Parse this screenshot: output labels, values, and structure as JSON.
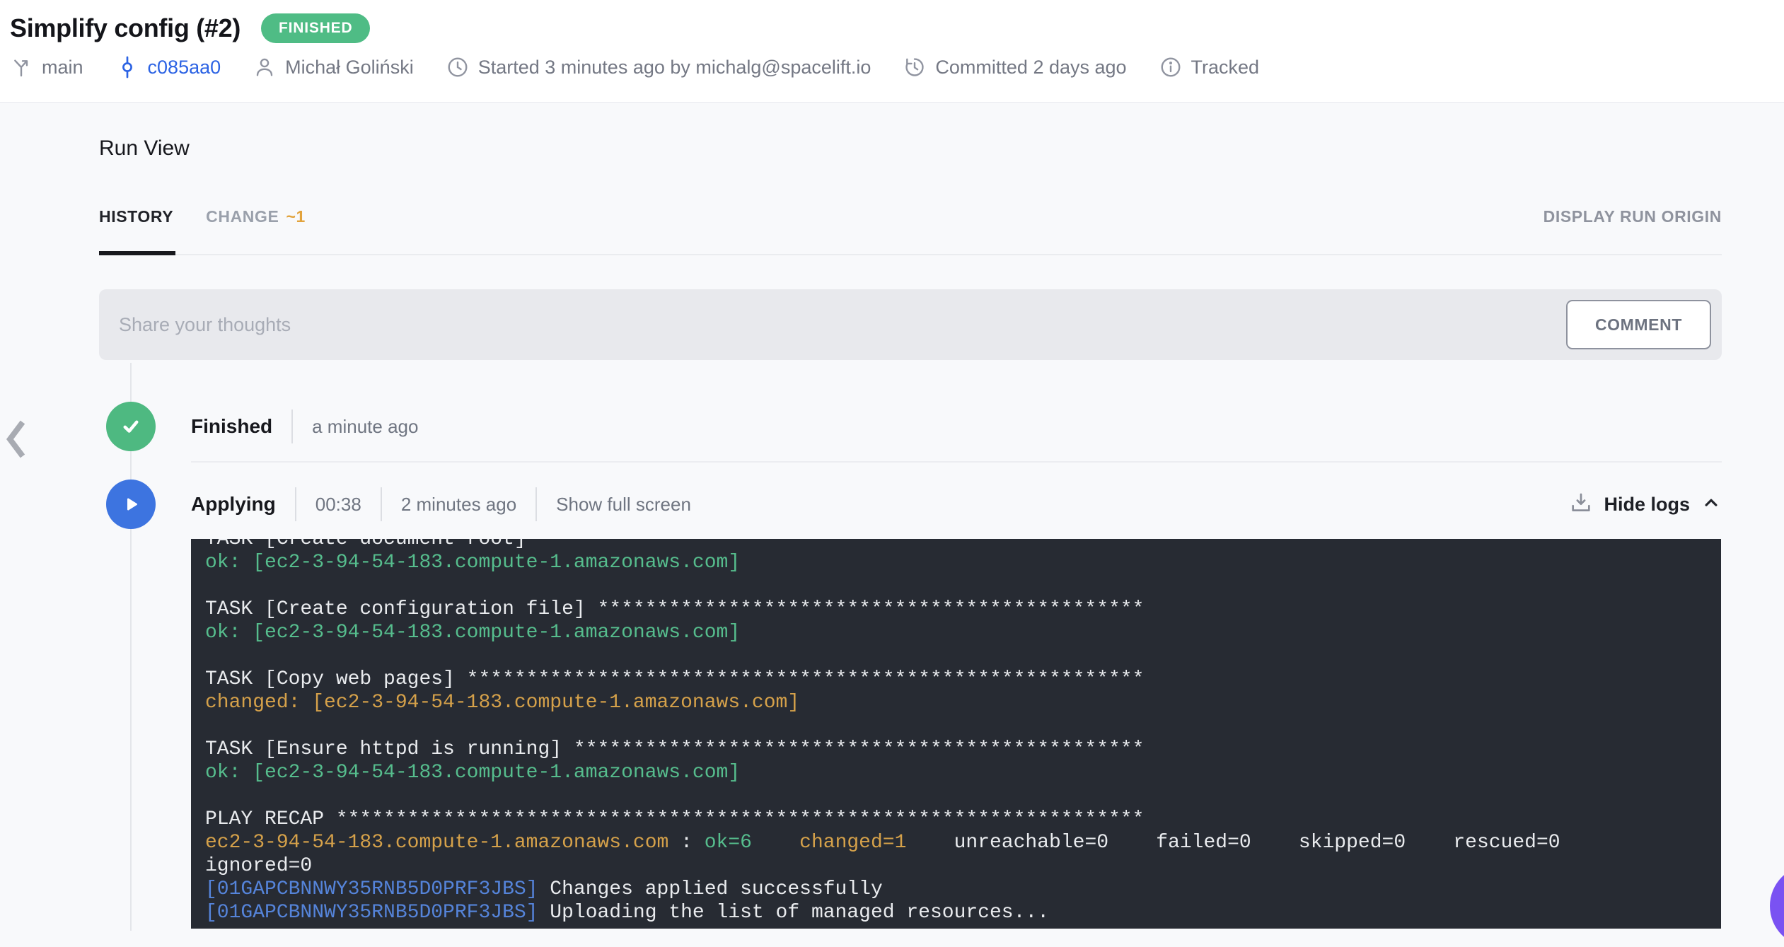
{
  "header": {
    "title": "Simplify config (#2)",
    "status_badge": "FINISHED",
    "meta": {
      "branch": "main",
      "commit": "c085aa0",
      "author": "Michał Goliński",
      "started": "Started 3 minutes ago by michalg@spacelift.io",
      "committed": "Committed 2 days ago",
      "tracking": "Tracked"
    }
  },
  "run_view": {
    "heading": "Run View",
    "tabs": {
      "history": "HISTORY",
      "change": "CHANGE",
      "change_count": "~1"
    },
    "display_run_origin": "DISPLAY RUN ORIGIN",
    "comment": {
      "placeholder": "Share your thoughts",
      "button": "COMMENT"
    }
  },
  "timeline": {
    "finished": {
      "status": "Finished",
      "time": "a minute ago"
    },
    "applying": {
      "status": "Applying",
      "duration": "00:38",
      "time": "2 minutes ago",
      "fullscreen_link": "Show full screen",
      "hide_logs": "Hide logs"
    }
  },
  "colors": {
    "badge_green": "#4fbc85",
    "status_green": "#4eb981",
    "status_blue": "#3d74e0",
    "commit_blue": "#2c63e4",
    "tab_count_orange": "#e2a33c",
    "terminal_bg": "#272b33",
    "log_white": "#e9ebee",
    "log_green": "#56bd8d",
    "log_orange": "#d5a14a",
    "log_blue": "#5584da",
    "chat_bubble": "#7a52f2"
  },
  "terminal": {
    "lines": [
      [
        {
          "c": "w",
          "t": "TASK [Create document root] ***************************************************"
        }
      ],
      [
        {
          "c": "g",
          "t": "ok: [ec2-3-94-54-183.compute-1.amazonaws.com]"
        }
      ],
      [],
      [
        {
          "c": "w",
          "t": "TASK [Create configuration file] **********************************************"
        }
      ],
      [
        {
          "c": "g",
          "t": "ok: [ec2-3-94-54-183.compute-1.amazonaws.com]"
        }
      ],
      [],
      [
        {
          "c": "w",
          "t": "TASK [Copy web pages] *********************************************************"
        }
      ],
      [
        {
          "c": "o",
          "t": "changed: [ec2-3-94-54-183.compute-1.amazonaws.com]"
        }
      ],
      [],
      [
        {
          "c": "w",
          "t": "TASK [Ensure httpd is running] ************************************************"
        }
      ],
      [
        {
          "c": "g",
          "t": "ok: [ec2-3-94-54-183.compute-1.amazonaws.com]"
        }
      ],
      [],
      [
        {
          "c": "w",
          "t": "PLAY RECAP ********************************************************************"
        }
      ],
      [
        {
          "c": "o",
          "t": "ec2-3-94-54-183.compute-1.amazonaws.com"
        },
        {
          "c": "w",
          "t": " : "
        },
        {
          "c": "g",
          "t": "ok=6"
        },
        {
          "c": "w",
          "t": "    "
        },
        {
          "c": "o",
          "t": "changed=1"
        },
        {
          "c": "w",
          "t": "    unreachable=0    failed=0    skipped=0    rescued=0"
        }
      ],
      [
        {
          "c": "w",
          "t": "ignored=0"
        }
      ],
      [
        {
          "c": "b",
          "t": "[01GAPCBNNWY35RNB5D0PRF3JBS]"
        },
        {
          "c": "w",
          "t": " Changes applied successfully"
        }
      ],
      [
        {
          "c": "b",
          "t": "[01GAPCBNNWY35RNB5D0PRF3JBS]"
        },
        {
          "c": "w",
          "t": " Uploading the list of managed resources..."
        }
      ]
    ]
  }
}
